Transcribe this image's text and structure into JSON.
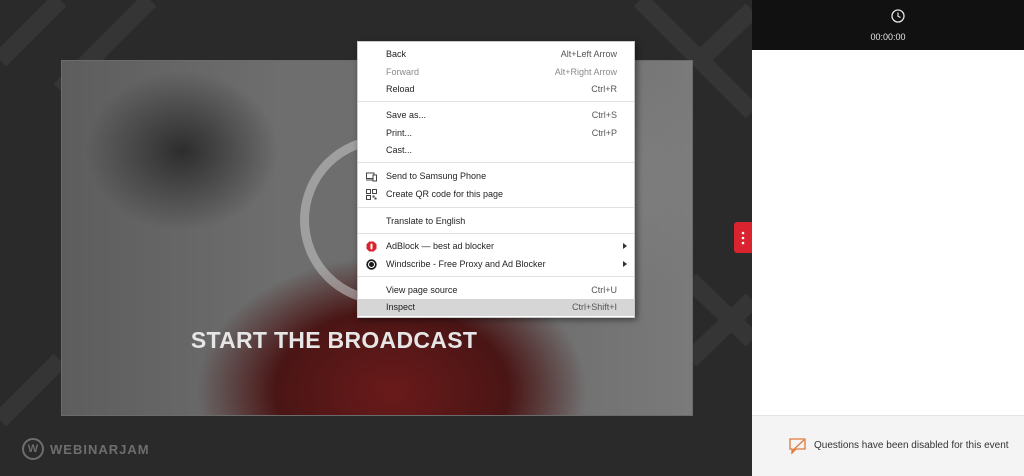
{
  "stage": {
    "headline": "START THE BROADCAST",
    "logo_text": "WEBINARJAM"
  },
  "panel": {
    "timer": "00:00:00",
    "questions_notice": "Questions have been disabled for this event"
  },
  "context_menu": {
    "back": {
      "label": "Back",
      "shortcut": "Alt+Left Arrow"
    },
    "forward": {
      "label": "Forward",
      "shortcut": "Alt+Right Arrow"
    },
    "reload": {
      "label": "Reload",
      "shortcut": "Ctrl+R"
    },
    "save_as": {
      "label": "Save as...",
      "shortcut": "Ctrl+S"
    },
    "print": {
      "label": "Print...",
      "shortcut": "Ctrl+P"
    },
    "cast": {
      "label": "Cast..."
    },
    "send_to_phone": {
      "label": "Send to Samsung Phone"
    },
    "qr_code": {
      "label": "Create QR code for this page"
    },
    "translate": {
      "label": "Translate to English"
    },
    "adblock": {
      "label": "AdBlock — best ad blocker"
    },
    "windscribe": {
      "label": "Windscribe - Free Proxy and Ad Blocker"
    },
    "view_source": {
      "label": "View page source",
      "shortcut": "Ctrl+U"
    },
    "inspect": {
      "label": "Inspect",
      "shortcut": "Ctrl+Shift+I"
    }
  },
  "colors": {
    "accent_red": "#d9232e",
    "menu_hover": "#d6d6d6",
    "panel_header": "#111111"
  }
}
